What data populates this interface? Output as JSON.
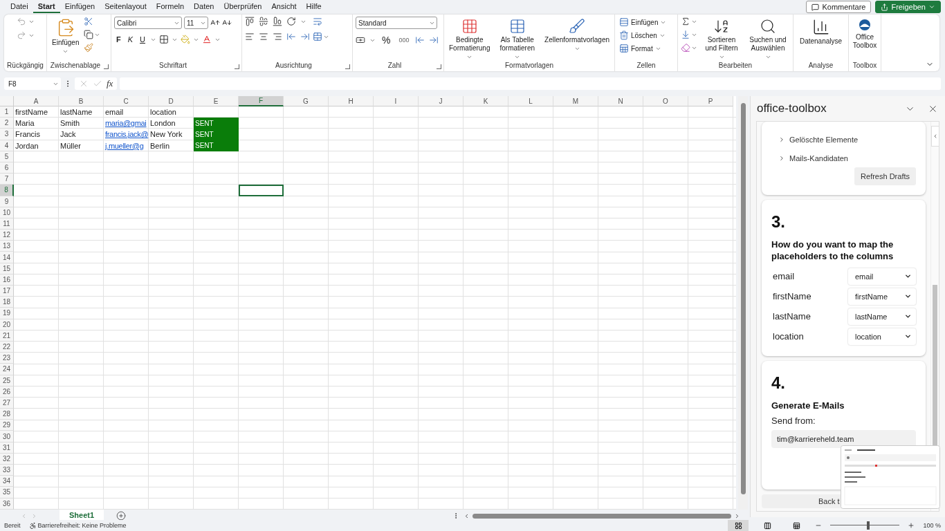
{
  "menu_tabs": [
    {
      "label": "Datei",
      "selected": false
    },
    {
      "label": "Start",
      "selected": true
    },
    {
      "label": "Einfügen",
      "selected": false
    },
    {
      "label": "Seitenlayout",
      "selected": false
    },
    {
      "label": "Formeln",
      "selected": false
    },
    {
      "label": "Daten",
      "selected": false
    },
    {
      "label": "Überprüfen",
      "selected": false
    },
    {
      "label": "Ansicht",
      "selected": false
    },
    {
      "label": "Hilfe",
      "selected": false
    }
  ],
  "top_buttons": {
    "comments": "Kommentare",
    "share": "Freigeben"
  },
  "ribbon": {
    "groups": [
      {
        "label": "Rückgängig"
      },
      {
        "label": "Zwischenablage",
        "buttons": [
          "Einfügen"
        ]
      },
      {
        "label": "Schriftart",
        "font": "Calibri",
        "size": "11",
        "bold": "F",
        "italic": "K",
        "underline": "U"
      },
      {
        "label": "Ausrichtung"
      },
      {
        "label": "Zahl",
        "format": "Standard",
        "percent": "%",
        "thousands": "000"
      },
      {
        "label": "Formatvorlagen",
        "buttons": [
          "Bedingte Formatierung",
          "Als Tabelle formatieren",
          "Zellenformatvorlagen"
        ]
      },
      {
        "label": "Zellen",
        "buttons": [
          "Einfügen",
          "Löschen",
          "Format"
        ]
      },
      {
        "label": "Bearbeiten",
        "buttons": [
          "Sortieren und Filtern",
          "Suchen und Auswählen"
        ]
      },
      {
        "label": "Analyse",
        "buttons": [
          "Datenanalyse"
        ]
      },
      {
        "label": "Toolbox",
        "buttons": [
          "Office Toolbox"
        ]
      }
    ]
  },
  "formula_bar": {
    "name_box": "F8",
    "fx": "fx"
  },
  "sheet": {
    "columns": [
      {
        "label": "A",
        "selected": false
      },
      {
        "label": "B",
        "selected": false
      },
      {
        "label": "C",
        "selected": false
      },
      {
        "label": "D",
        "selected": false
      },
      {
        "label": "E",
        "selected": false
      },
      {
        "label": "F",
        "selected": true
      },
      {
        "label": "G",
        "selected": false
      },
      {
        "label": "H",
        "selected": false
      },
      {
        "label": "I",
        "selected": false
      },
      {
        "label": "J",
        "selected": false
      },
      {
        "label": "K",
        "selected": false
      },
      {
        "label": "L",
        "selected": false
      },
      {
        "label": "M",
        "selected": false
      },
      {
        "label": "N",
        "selected": false
      },
      {
        "label": "O",
        "selected": false
      },
      {
        "label": "P",
        "selected": false
      }
    ],
    "rows": [
      {
        "number": "1",
        "selected": false,
        "cells": [
          {
            "text": "firstName",
            "kind": "text"
          },
          {
            "text": "lastName",
            "kind": "text"
          },
          {
            "text": "email",
            "kind": "text"
          },
          {
            "text": "location",
            "kind": "text"
          }
        ]
      },
      {
        "number": "2",
        "selected": false,
        "cells": [
          {
            "text": "Maria",
            "kind": "text"
          },
          {
            "text": "Smith",
            "kind": "text"
          },
          {
            "text": "maria@gmai",
            "kind": "link"
          },
          {
            "text": "London",
            "kind": "text"
          },
          {
            "text": "SENT",
            "kind": "status"
          }
        ]
      },
      {
        "number": "3",
        "selected": false,
        "cells": [
          {
            "text": "Francis",
            "kind": "text"
          },
          {
            "text": "Jack",
            "kind": "text"
          },
          {
            "text": "francis.jack@",
            "kind": "link"
          },
          {
            "text": "New York",
            "kind": "text"
          },
          {
            "text": "SENT",
            "kind": "status"
          }
        ]
      },
      {
        "number": "4",
        "selected": false,
        "cells": [
          {
            "text": "Jordan",
            "kind": "text"
          },
          {
            "text": "Müller",
            "kind": "text"
          },
          {
            "text": "j.mueller@g",
            "kind": "link"
          },
          {
            "text": "Berlin",
            "kind": "text"
          },
          {
            "text": "SENT",
            "kind": "status"
          }
        ]
      },
      {
        "number": "5",
        "selected": false
      },
      {
        "number": "6",
        "selected": false
      },
      {
        "number": "7",
        "selected": false
      },
      {
        "number": "8",
        "selected": true
      },
      {
        "number": "9",
        "selected": false
      },
      {
        "number": "10",
        "selected": false
      },
      {
        "number": "11",
        "selected": false
      },
      {
        "number": "12",
        "selected": false
      },
      {
        "number": "13",
        "selected": false
      },
      {
        "number": "14",
        "selected": false
      },
      {
        "number": "15",
        "selected": false
      },
      {
        "number": "16",
        "selected": false
      },
      {
        "number": "17",
        "selected": false
      },
      {
        "number": "18",
        "selected": false
      },
      {
        "number": "19",
        "selected": false
      },
      {
        "number": "20",
        "selected": false
      },
      {
        "number": "21",
        "selected": false
      },
      {
        "number": "22",
        "selected": false
      },
      {
        "number": "23",
        "selected": false
      },
      {
        "number": "24",
        "selected": false
      },
      {
        "number": "25",
        "selected": false
      },
      {
        "number": "26",
        "selected": false
      },
      {
        "number": "27",
        "selected": false
      },
      {
        "number": "28",
        "selected": false
      },
      {
        "number": "29",
        "selected": false
      },
      {
        "number": "30",
        "selected": false
      },
      {
        "number": "31",
        "selected": false
      },
      {
        "number": "32",
        "selected": false
      },
      {
        "number": "33",
        "selected": false
      },
      {
        "number": "34",
        "selected": false
      },
      {
        "number": "35",
        "selected": false
      },
      {
        "number": "36",
        "selected": false
      }
    ]
  },
  "sheet_tabs": [
    {
      "label": "Sheet1",
      "selected": true
    }
  ],
  "task_pane": {
    "title": "office-toolbox",
    "folders": [
      {
        "label": "Gelöschte Elemente",
        "expanded": false
      },
      {
        "label": "Mails-Kandidaten",
        "expanded": false
      }
    ],
    "refresh_button": "Refresh Drafts",
    "mapping": {
      "number": "3.",
      "heading": "How do you want to map the placeholders to the columns",
      "rows": [
        {
          "placeholder": "email",
          "column": "email"
        },
        {
          "placeholder": "firstName",
          "column": "firstName"
        },
        {
          "placeholder": "lastName",
          "column": "lastName"
        },
        {
          "placeholder": "location",
          "column": "location"
        }
      ]
    },
    "generate": {
      "number": "4.",
      "heading": "Generate E-Mails",
      "send_from_label": "Send from:",
      "send_from": "tim@karriereheld.team"
    },
    "back_button": "Back t"
  },
  "status_bar": {
    "status": "Bereit",
    "accessibility": "Barrierefreiheit: Keine Probleme",
    "views": [
      {
        "selected": true
      },
      {
        "selected": false
      },
      {
        "selected": false
      }
    ],
    "zoom": {
      "level": 0.55,
      "label": "100 %"
    }
  }
}
